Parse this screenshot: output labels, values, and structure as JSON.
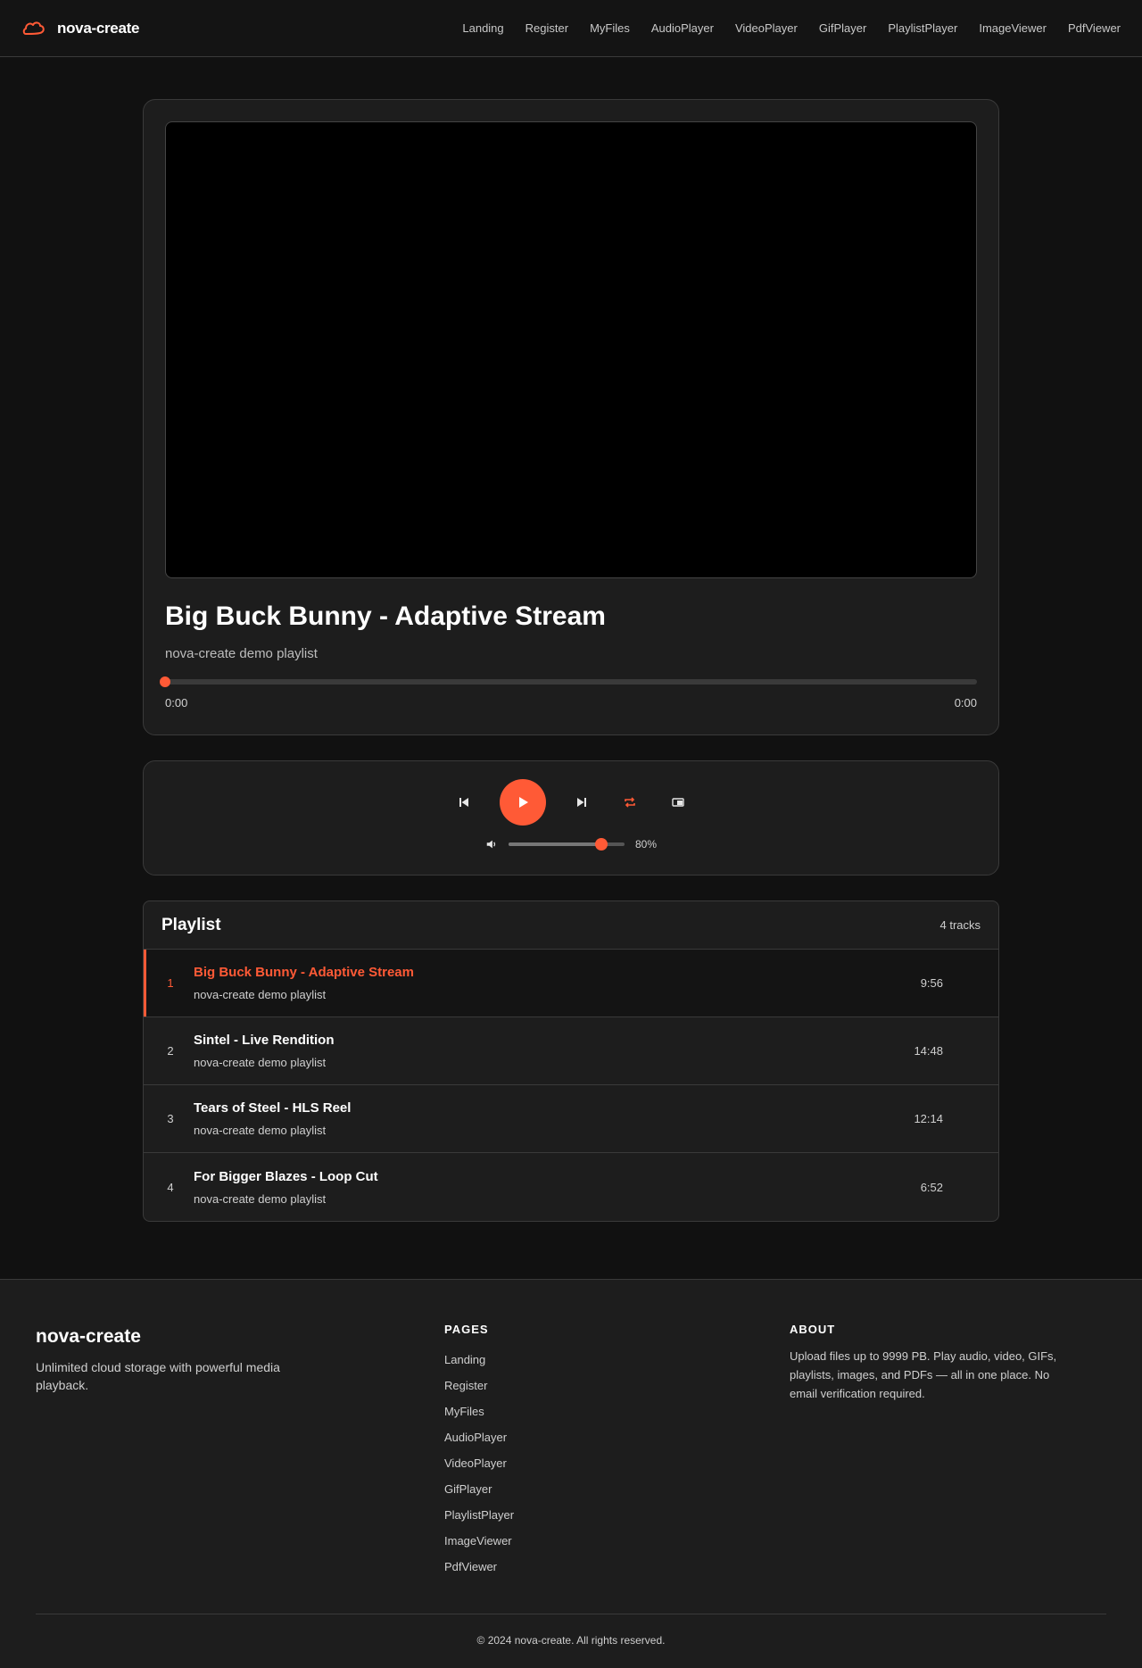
{
  "brand": {
    "name": "nova-create",
    "accent": "#ff5a36"
  },
  "nav": [
    "Landing",
    "Register",
    "MyFiles",
    "AudioPlayer",
    "VideoPlayer",
    "GifPlayer",
    "PlaylistPlayer",
    "ImageViewer",
    "PdfViewer"
  ],
  "player": {
    "title": "Big Buck Bunny - Adaptive Stream",
    "subtitle": "nova-create demo playlist",
    "current_time": "0:00",
    "total_time": "0:00",
    "progress": 0
  },
  "controls": {
    "icons": [
      "skip-previous-icon",
      "play-icon",
      "skip-next-icon",
      "repeat-icon",
      "shuffle-icon",
      "volume-icon"
    ],
    "volume": 80,
    "volume_label": "80%"
  },
  "playlist": {
    "title": "Playlist",
    "count_label": "4 tracks",
    "tracks": [
      {
        "num": "1",
        "name": "Big Buck Bunny - Adaptive Stream",
        "artist": "nova-create demo playlist",
        "duration": "9:56",
        "active": true
      },
      {
        "num": "2",
        "name": "Sintel - Live Rendition",
        "artist": "nova-create demo playlist",
        "duration": "14:48",
        "active": false
      },
      {
        "num": "3",
        "name": "Tears of Steel - HLS Reel",
        "artist": "nova-create demo playlist",
        "duration": "12:14",
        "active": false
      },
      {
        "num": "4",
        "name": "For Bigger Blazes - Loop Cut",
        "artist": "nova-create demo playlist",
        "duration": "6:52",
        "active": false
      }
    ]
  },
  "footer": {
    "brand_name": "nova-create",
    "tagline": "Unlimited cloud storage with powerful media playback.",
    "pages_heading": "PAGES",
    "pages": [
      "Landing",
      "Register",
      "MyFiles",
      "AudioPlayer",
      "VideoPlayer",
      "GifPlayer",
      "PlaylistPlayer",
      "ImageViewer",
      "PdfViewer"
    ],
    "about_heading": "ABOUT",
    "about_text": "Upload files up to 9999 PB. Play audio, video, GIFs, playlists, images, and PDFs — all in one place. No email verification required.",
    "copyright": "© 2024 nova-create. All rights reserved."
  }
}
